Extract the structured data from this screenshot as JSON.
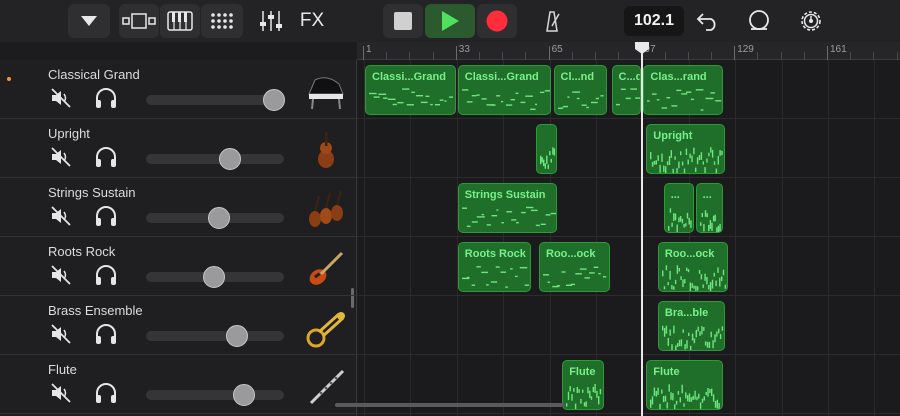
{
  "toolbar": {
    "tempo": "102.1",
    "fx_label": "FX"
  },
  "ruler": {
    "bars": [
      "1",
      "33",
      "65",
      "97",
      "129",
      "161"
    ]
  },
  "playhead_bar": 97,
  "tracks": [
    {
      "name": "Classical Grand",
      "volume": 0.93,
      "icon": "piano-icon",
      "selected": true
    },
    {
      "name": "Upright",
      "volume": 0.61,
      "icon": "upright-bass-icon",
      "selected": false
    },
    {
      "name": "Strings Sustain",
      "volume": 0.53,
      "icon": "strings-icon",
      "selected": false
    },
    {
      "name": "Roots Rock",
      "volume": 0.49,
      "icon": "electric-guitar-icon",
      "selected": false
    },
    {
      "name": "Brass Ensemble",
      "volume": 0.66,
      "icon": "brass-icon",
      "selected": false
    },
    {
      "name": "Flute",
      "volume": 0.71,
      "icon": "flute-icon",
      "selected": false
    }
  ],
  "regions": [
    {
      "track": 0,
      "start": 1,
      "end": 33,
      "label": "Classi...Grand"
    },
    {
      "track": 0,
      "start": 33,
      "end": 66,
      "label": "Classi...Grand"
    },
    {
      "track": 0,
      "start": 66,
      "end": 85,
      "label": "Cl...nd"
    },
    {
      "track": 0,
      "start": 86,
      "end": 97,
      "label": "C...d"
    },
    {
      "track": 0,
      "start": 97,
      "end": 125,
      "label": "Clas...rand"
    },
    {
      "track": 1,
      "start": 60,
      "end": 68,
      "label": ""
    },
    {
      "track": 1,
      "start": 98,
      "end": 126,
      "label": "Upright"
    },
    {
      "track": 2,
      "start": 33,
      "end": 68,
      "label": "Strings Sustain"
    },
    {
      "track": 2,
      "start": 104,
      "end": 115,
      "label": "..."
    },
    {
      "track": 2,
      "start": 115,
      "end": 125,
      "label": "..."
    },
    {
      "track": 3,
      "start": 33,
      "end": 59,
      "label": "Roots Rock"
    },
    {
      "track": 3,
      "start": 61,
      "end": 86,
      "label": "Roo...ock"
    },
    {
      "track": 3,
      "start": 102,
      "end": 127,
      "label": "Roo...ock"
    },
    {
      "track": 4,
      "start": 102,
      "end": 126,
      "label": "Bra...ble"
    },
    {
      "track": 5,
      "start": 69,
      "end": 84,
      "label": "Flute"
    },
    {
      "track": 5,
      "start": 98,
      "end": 125,
      "label": "Flute"
    }
  ]
}
